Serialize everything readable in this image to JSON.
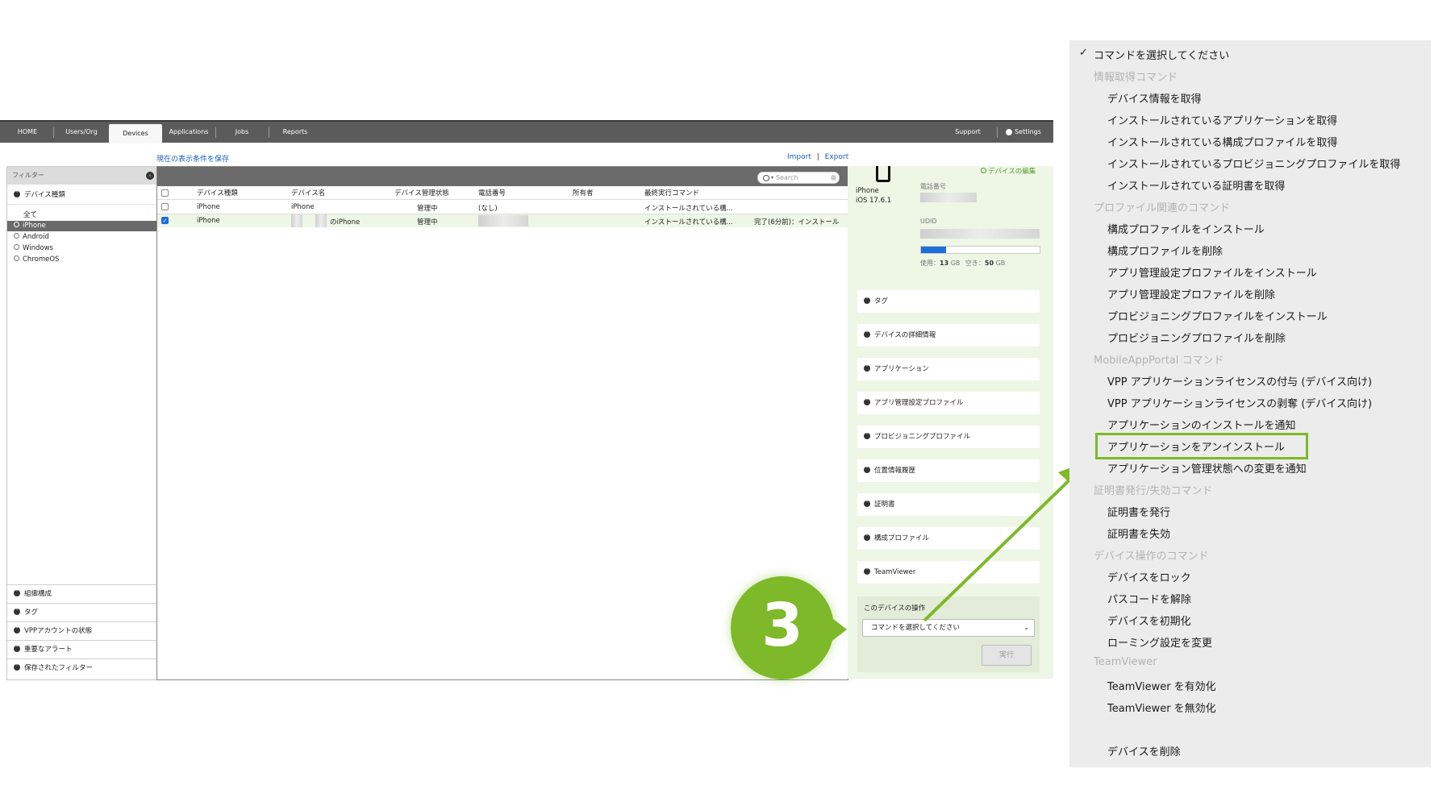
{
  "nav": {
    "home": "HOME",
    "users": "Users/Org",
    "devices": "Devices",
    "applications": "Applications",
    "jobs": "Jobs",
    "reports": "Reports",
    "support": "Support",
    "settings": "Settings"
  },
  "toolbar": {
    "save_view": "現在の表示条件を保存",
    "import": "Import",
    "separator": "|",
    "export": "Export"
  },
  "sidebar": {
    "title": "フィルター",
    "device_type": "デバイス種類",
    "all": "全て",
    "types": [
      "iPhone",
      "Android",
      "Windows",
      "ChromeOS"
    ],
    "sections": [
      "組織構成",
      "タグ",
      "VPPアカウントの状態",
      "重要なアラート",
      "保存されたフィルター"
    ]
  },
  "table": {
    "search_placeholder": "Search",
    "headers": [
      "デバイス種類",
      "デバイス名",
      "デバイス管理状態",
      "電話番号",
      "所有者",
      "最終実行コマンド"
    ],
    "rows": [
      {
        "type": "iPhone",
        "name": "iPhone",
        "status": "管理中",
        "phone": "(なし)",
        "owner": "",
        "last_command": "インストールされている構...",
        "result": ""
      },
      {
        "type": "iPhone",
        "name": "のiPhone",
        "status": "管理中",
        "phone": "",
        "owner": "",
        "last_command": "インストールされている構...",
        "result": "完了(6分前)：インストール"
      }
    ]
  },
  "device_panel": {
    "edit_link": "デバイスの編集",
    "model": "iPhone",
    "os": "iOS 17.6.1",
    "phone_label": "電話番号",
    "udid_label": "UDID",
    "used_label": "使用：",
    "used_value": "13",
    "used_unit": "GB",
    "free_label": "空き：",
    "free_value": "50",
    "free_unit": "GB",
    "storage_used_fraction": 0.21,
    "sections": [
      "タグ",
      "デバイスの詳細情報",
      "アプリケーション",
      "アプリ管理設定プロファイル",
      "プロビジョニングプロファイル",
      "位置情報履歴",
      "証明書",
      "構成プロファイル",
      "TeamViewer"
    ],
    "operations_title": "このデバイスの操作",
    "select_value": "コマンドを選択してください",
    "execute_button": "実行"
  },
  "step_badge": "3",
  "dropdown": {
    "check_mark": "✓",
    "selected": "コマンドを選択してください",
    "groups": [
      {
        "header": "情報取得コマンド",
        "items": [
          "デバイス情報を取得",
          "インストールされているアプリケーションを取得",
          "インストールされている構成プロファイルを取得",
          "インストールされているプロビジョニングプロファイルを取得",
          "インストールされている証明書を取得"
        ]
      },
      {
        "header": "プロファイル関連のコマンド",
        "items": [
          "構成プロファイルをインストール",
          "構成プロファイルを削除",
          "アプリ管理設定プロファイルをインストール",
          "アプリ管理設定プロファイルを削除",
          "プロビジョニングプロファイルをインストール",
          "プロビジョニングプロファイルを削除"
        ]
      },
      {
        "header": "MobileAppPortal コマンド",
        "items": [
          "VPP アプリケーションライセンスの付与 (デバイス向け)",
          "VPP アプリケーションライセンスの剥奪 (デバイス向け)",
          "アプリケーションのインストールを通知",
          "アプリケーションをアンインストール",
          "アプリケーション管理状態への変更を通知"
        ]
      },
      {
        "header": "証明書発行/失効コマンド",
        "items": [
          "証明書を発行",
          "証明書を失効"
        ]
      },
      {
        "header": "デバイス操作のコマンド",
        "items": [
          "デバイスをロック",
          "パスコードを解除",
          "デバイスを初期化",
          "ローミング設定を変更"
        ]
      },
      {
        "header": "TeamViewer",
        "items": [
          "TeamViewer を有効化",
          "TeamViewer を無効化"
        ]
      }
    ],
    "delete": "デバイスを削除",
    "highlighted": "アプリケーションをアンインストール"
  },
  "colors": {
    "accent_green": "#7db928",
    "panel_green": "#eef6e6",
    "link_blue": "#1a5fb4",
    "nav_gray": "#5b5b5b"
  }
}
